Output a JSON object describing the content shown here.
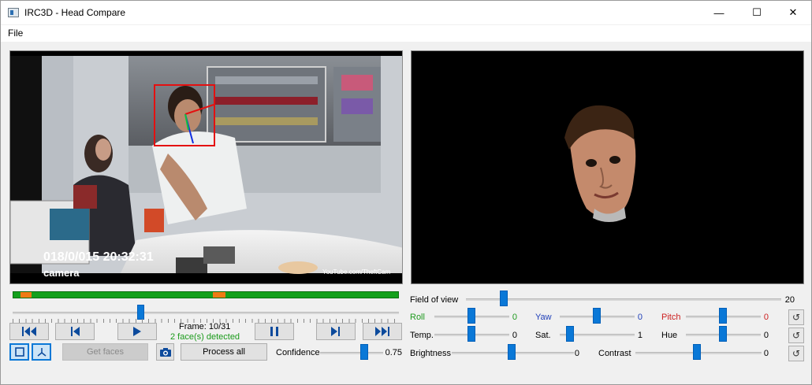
{
  "window": {
    "title": "IRC3D - Head Compare",
    "minimize_glyph": "—",
    "maximize_glyph": "☐",
    "close_glyph": "✕"
  },
  "menu": {
    "file": "File"
  },
  "video": {
    "overlay_timestamp": "018/0/015 20:32:31",
    "overlay_watermark": "YouTube.com/TheftCam",
    "overlay_bottom_left": "camera"
  },
  "playback": {
    "frame_label": "Frame: 10/31",
    "faces_detected": "2 face(s) detected",
    "faces_color": "#1a9a1a",
    "timeline_markers": [
      0.02,
      0.52
    ],
    "seek_fraction": 0.335
  },
  "buttons": {
    "get_faces": "Get faces",
    "process_all": "Process all",
    "skip_start_icon": "skip-to-start-icon",
    "prev_frame_icon": "step-back-icon",
    "play_icon": "play-icon",
    "pause_icon": "pause-icon",
    "next_frame_icon": "step-forward-icon",
    "skip_end_icon": "skip-to-end-icon",
    "camera_icon": "camera-icon"
  },
  "confidence": {
    "label": "Confidence",
    "value": "0.75",
    "fraction": 0.75
  },
  "field_of_view": {
    "label": "Field of view",
    "value": "20",
    "fraction": 0.11
  },
  "rotation": {
    "roll": {
      "label": "Roll",
      "value": "0",
      "color": "#1f9a1f",
      "fraction": 0.5
    },
    "yaw": {
      "label": "Yaw",
      "value": "0",
      "color": "#1f3fb8",
      "fraction": 0.5
    },
    "pitch": {
      "label": "Pitch",
      "value": "0",
      "color": "#cc1f1f",
      "fraction": 0.5
    }
  },
  "color": {
    "temp": {
      "label": "Temp.",
      "value": "0",
      "fraction": 0.5
    },
    "sat": {
      "label": "Sat.",
      "value": "1",
      "fraction": 0.1
    },
    "hue": {
      "label": "Hue",
      "value": "0",
      "fraction": 0.5
    }
  },
  "tone": {
    "brightness": {
      "label": "Brightness",
      "value": "0",
      "fraction": 0.5
    },
    "contrast": {
      "label": "Contrast",
      "value": "0",
      "fraction": 0.5
    }
  },
  "accent": "#0a78d7"
}
